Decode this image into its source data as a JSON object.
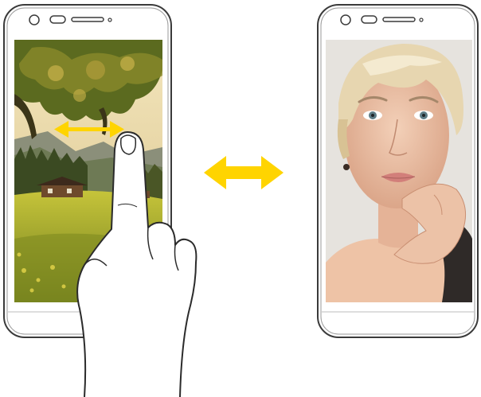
{
  "illustration": {
    "subject": "swipe-between-screens",
    "icons": [
      "smartphone-left",
      "smartphone-right",
      "swipe-hint-arrow",
      "swap-arrow",
      "pointing-hand"
    ],
    "colors": {
      "phone_outline": "#3a3a3a",
      "phone_body": "#ffffff",
      "arrow_yellow": "#ffd400",
      "hand_outline": "#2b2b2b",
      "sky": "#e9d7a8",
      "foliage_dark": "#5b6a1f",
      "foliage_light": "#c9b24a",
      "grass": "#a9b52c",
      "mountain": "#8b8f7a",
      "portrait_background": "#e6e3de",
      "hair": "#e7d6b0",
      "skin": "#ecc2a7"
    },
    "left_screen_image": "landscape-tree-and-house",
    "right_screen_image": "portrait-blonde-woman"
  }
}
